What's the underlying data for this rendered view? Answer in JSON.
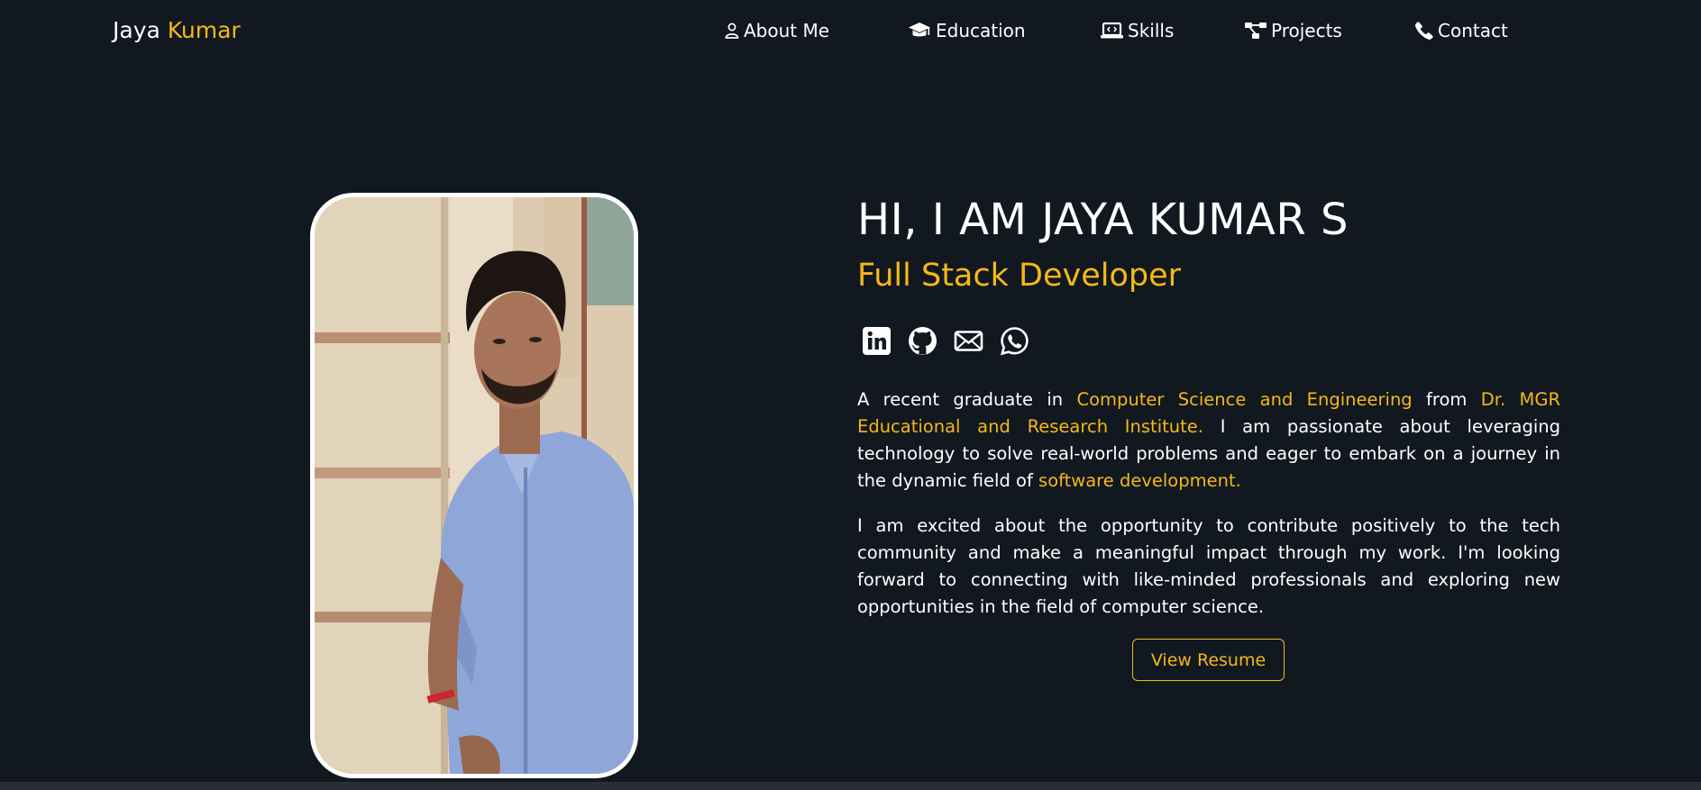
{
  "brand": {
    "first": "Jaya",
    "last": "Kumar"
  },
  "nav": {
    "about": {
      "label": "About Me",
      "icon": "user-icon"
    },
    "education": {
      "label": "Education",
      "icon": "graduation-cap-icon"
    },
    "skills": {
      "label": "Skills",
      "icon": "laptop-code-icon"
    },
    "projects": {
      "label": "Projects",
      "icon": "project-diagram-icon"
    },
    "contact": {
      "label": "Contact",
      "icon": "phone-icon"
    }
  },
  "hero": {
    "title": "HI, I AM JAYA KUMAR S",
    "subtitle": "Full Stack Developer",
    "socials": [
      "linkedin-icon",
      "github-icon",
      "mail-icon",
      "whatsapp-icon"
    ],
    "para1": {
      "t1": "A recent graduate in ",
      "h1": "Computer Science and Engineering",
      "t2": " from ",
      "h2": "Dr. MGR Educational and Research Institute.",
      "t3": " I am passionate about leveraging technology to solve real-world problems and eager to embark on a journey in the dynamic field of ",
      "h3": "software development."
    },
    "para2": "I am excited about the opportunity to contribute positively to the tech community and make a meaningful impact through my work. I'm looking forward to connecting with like-minded professionals and exploring new opportunities in the field of computer science.",
    "resume_label": "View Resume"
  },
  "colors": {
    "background": "#111820",
    "accent": "#f5b915",
    "text": "#ffffff"
  }
}
